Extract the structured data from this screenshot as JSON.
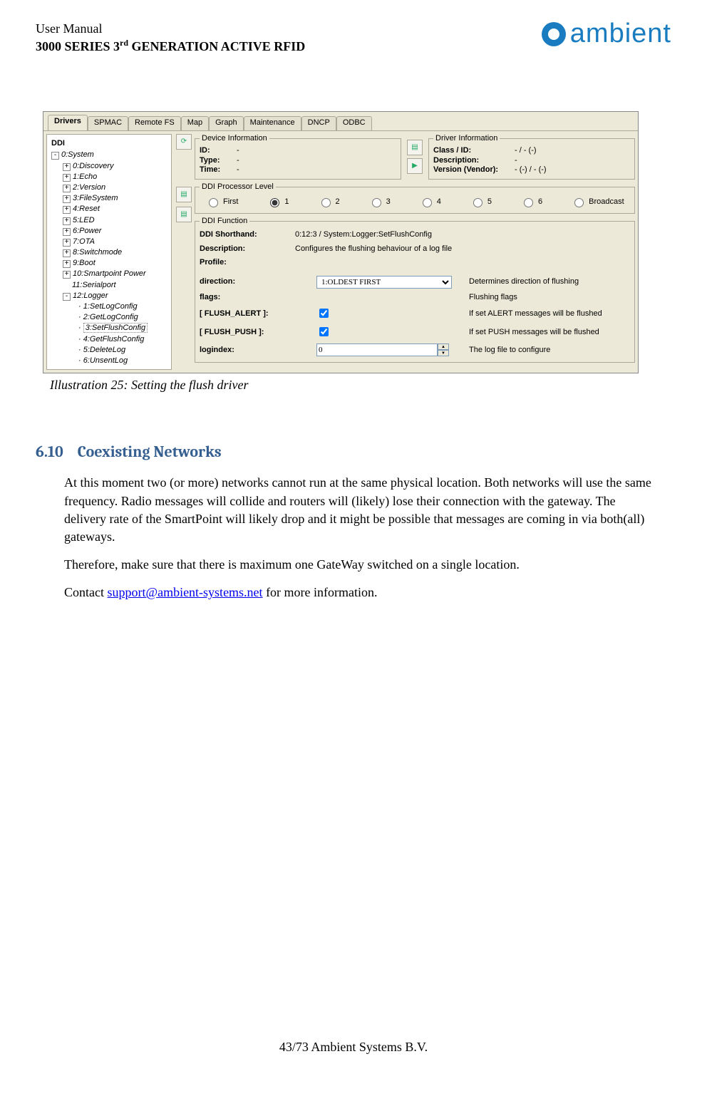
{
  "header": {
    "line1": "User Manual",
    "line2_a": "3000 SERIES 3",
    "line2_sup": "rd",
    "line2_b": " GENERATION ACTIVE RFID",
    "logo_text": "ambient"
  },
  "app": {
    "tabs": [
      "Drivers",
      "SPMAC",
      "Remote FS",
      "Map",
      "Graph",
      "Maintenance",
      "DNCP",
      "ODBC"
    ],
    "active_tab": 0,
    "sidebar_title": "DDI",
    "tree_root": "0:System",
    "tree": [
      {
        "t": "0:Discovery"
      },
      {
        "t": "1:Echo"
      },
      {
        "t": "2:Version"
      },
      {
        "t": "3:FileSystem"
      },
      {
        "t": "4:Reset"
      },
      {
        "t": "5:LED"
      },
      {
        "t": "6:Power"
      },
      {
        "t": "7:OTA"
      },
      {
        "t": "8:Switchmode"
      },
      {
        "t": "9:Boot"
      },
      {
        "t": "10:Smartpoint Power"
      },
      {
        "t": "11:Serialport",
        "leaf": true
      },
      {
        "t": "12:Logger",
        "open": true,
        "children": [
          "1:SetLogConfig",
          "2:GetLogConfig",
          "3:SetFlushConfig",
          "4:GetFlushConfig",
          "5:DeleteLog",
          "6:UnsentLog"
        ],
        "sel": 2
      }
    ],
    "device_info": {
      "title": "Device Information",
      "id_k": "ID:",
      "id_v": "-",
      "type_k": "Type:",
      "type_v": "-",
      "time_k": "Time:",
      "time_v": "-"
    },
    "driver_info": {
      "title": "Driver Information",
      "class_k": "Class / ID:",
      "class_v": "- / - (-)",
      "desc_k": "Description:",
      "desc_v": "-",
      "ver_k": "Version (Vendor):",
      "ver_v": "- (-) / - (-)"
    },
    "proc_level": {
      "title": "DDI Processor Level",
      "options": [
        "First",
        "1",
        "2",
        "3",
        "4",
        "5",
        "6",
        "Broadcast"
      ],
      "selected": 1
    },
    "func": {
      "title": "DDI Function",
      "shorthand_k": "DDI Shorthand:",
      "shorthand_v": "0:12:3 / System:Logger:SetFlushConfig",
      "desc_k": "Description:",
      "desc_v": "Configures the flushing behaviour of a log file",
      "profile_k": "Profile:",
      "rows": [
        {
          "lbl": "direction:",
          "ctl": "select",
          "val": "1:OLDEST FIRST",
          "help": "Determines direction of flushing"
        },
        {
          "lbl": "flags:",
          "ctl": "none",
          "help": "Flushing flags"
        },
        {
          "lbl": "[ FLUSH_ALERT ]:",
          "ctl": "check",
          "val": true,
          "help": "If set ALERT messages will be flushed"
        },
        {
          "lbl": "[ FLUSH_PUSH ]:",
          "ctl": "check",
          "val": true,
          "help": "If set PUSH messages will be flushed"
        },
        {
          "lbl": "logindex:",
          "ctl": "spin",
          "val": "0",
          "help": "The log file to configure"
        }
      ]
    }
  },
  "caption": "Illustration 25: Setting the flush driver",
  "section": {
    "num": "6.10",
    "title": "Coexisting Networks",
    "p1": "At this moment two (or more) networks cannot run at the same physical location. Both networks will use the same frequency. Radio messages will collide and routers will (likely) lose their connection with the gateway. The delivery rate of the SmartPoint will likely drop and it might be possible that messages are coming in via both(all) gateways.",
    "p2": "Therefore, make sure that there is maximum one GateWay switched on a single location.",
    "p3a": "Contact ",
    "mail": "support@ambient-systems.net",
    "p3b": " for more information."
  },
  "footer": "43/73     Ambient Systems B.V."
}
